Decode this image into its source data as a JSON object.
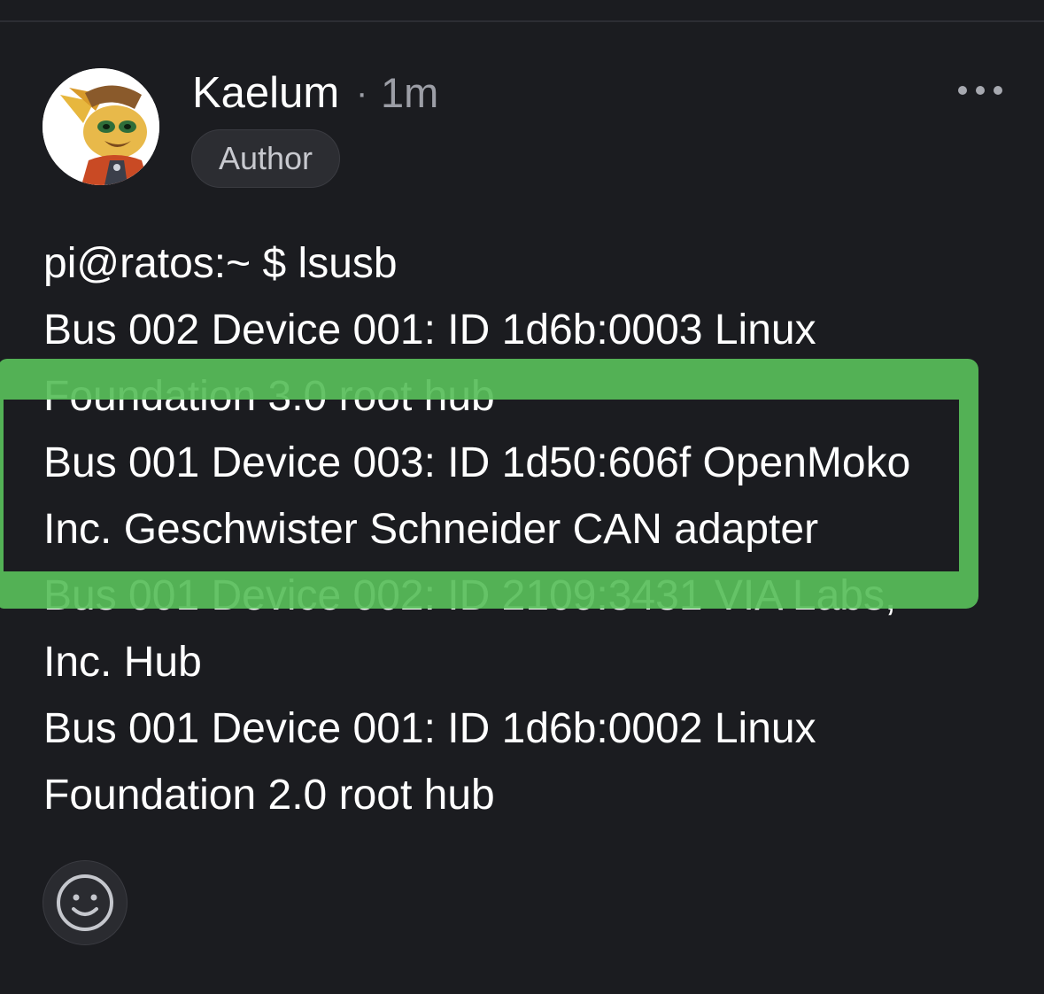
{
  "post": {
    "author": "Kaelum",
    "separator": "·",
    "timestamp": "1m",
    "badge": "Author",
    "lines": [
      "pi@ratos:~ $ lsusb",
      "Bus 002 Device 001: ID 1d6b:0003 Linux",
      "Foundation 3.0 root hub",
      "Bus 001 Device 003: ID 1d50:606f OpenMoko",
      "Inc. Geschwister Schneider CAN adapter",
      "Bus 001 Device 002: ID 2109:3431 VIA Labs,",
      "Inc. Hub",
      "Bus 001 Device 001: ID 1d6b:0002 Linux",
      "Foundation 2.0 root hub"
    ]
  },
  "icons": {
    "more": "more-horizontal-icon",
    "reaction": "smiley-face-icon",
    "avatar": "avatar-image"
  },
  "colors": {
    "background": "#1b1c20",
    "text": "#ffffff",
    "muted": "#9c9ea6",
    "highlight": "#58be5a"
  }
}
